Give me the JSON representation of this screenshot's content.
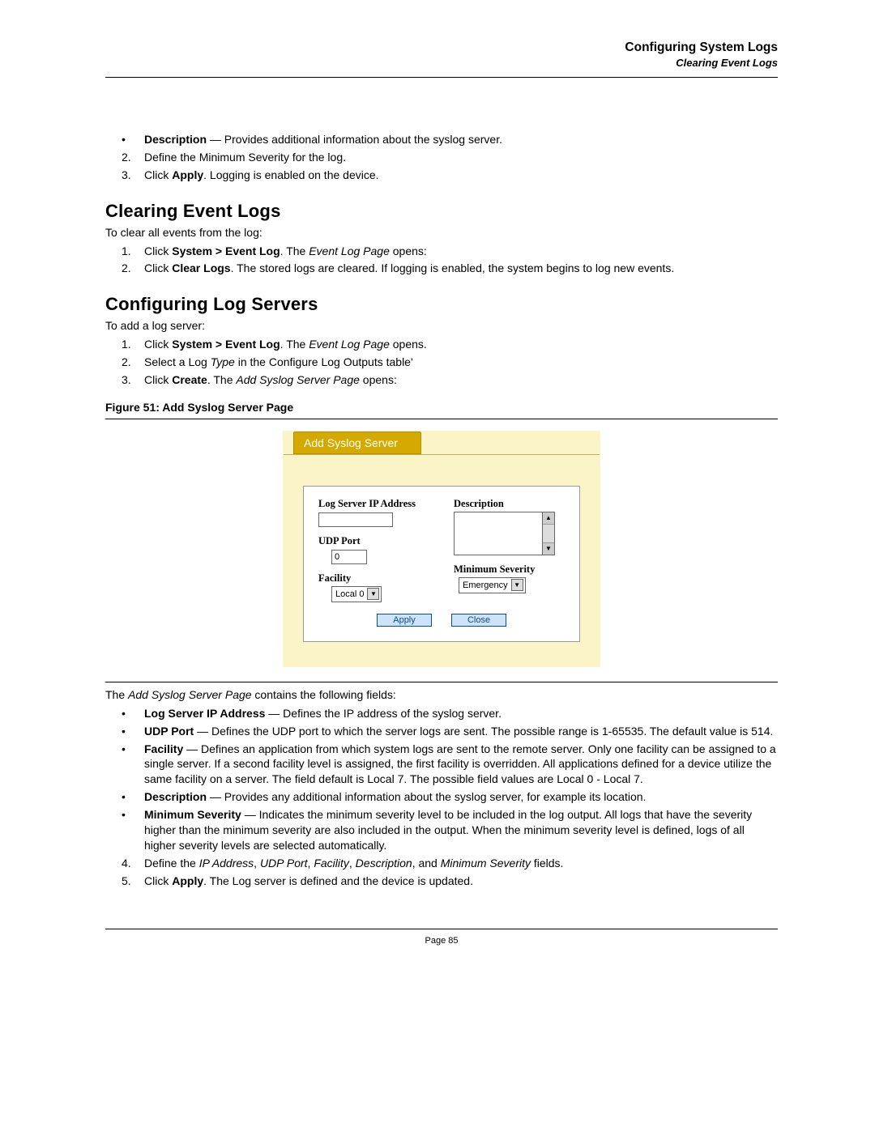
{
  "header": {
    "title": "Configuring System Logs",
    "subtitle": "Clearing Event Logs"
  },
  "intro": {
    "bullet": {
      "label": "Description",
      "dash": " — ",
      "text": "Provides additional information about the syslog server."
    },
    "step2": "Define the Minimum Severity for the log.",
    "step3_pre": "Click ",
    "step3_b": "Apply",
    "step3_post": ". Logging is enabled on the device."
  },
  "clearing": {
    "heading": "Clearing Event Logs",
    "intro": "To clear all events from the log:",
    "s1_pre": "Click ",
    "s1_b": "System > Event Log",
    "s1_mid": ". The ",
    "s1_i": "Event Log Page",
    "s1_post": " opens:",
    "s2_pre": "Click ",
    "s2_b": "Clear Logs",
    "s2_post": ". The stored logs are cleared. If logging is enabled, the system begins to log new events."
  },
  "config": {
    "heading": "Configuring Log Servers",
    "intro": "To add a log server:",
    "s1_pre": "Click ",
    "s1_b": "System > Event Log",
    "s1_mid": ". The ",
    "s1_i": "Event Log Page",
    "s1_post": " opens.",
    "s2_pre": "Select a Log ",
    "s2_i": "Type",
    "s2_post": " in the Configure Log Outputs table'",
    "s3_pre": "Click ",
    "s3_b": "Create",
    "s3_mid": ". The ",
    "s3_i": "Add Syslog Server Page",
    "s3_post": " opens:"
  },
  "figure": {
    "caption": "Figure 51:  Add Syslog Server Page",
    "tab": "Add Syslog Server",
    "labels": {
      "ip": "Log Server IP Address",
      "udp": "UDP Port",
      "udp_value": "0",
      "facility": "Facility",
      "facility_value": "Local 0",
      "description": "Description",
      "min_sev": "Minimum Severity",
      "min_sev_value": "Emergency"
    },
    "buttons": {
      "apply": "Apply",
      "close": "Close"
    }
  },
  "fields_intro_pre": "The ",
  "fields_intro_i": "Add Syslog Server Page",
  "fields_intro_post": " contains the following fields:",
  "fields": {
    "ip_b": "Log Server IP Address",
    "ip_t": " — Defines the IP address of the syslog server.",
    "udp_b": "UDP Port",
    "udp_t": " — Defines the UDP port to which the server logs are sent. The possible range is 1-65535. The default value is 514.",
    "fac_b": "Facility",
    "fac_t": " — Defines an application from which system logs are sent to the remote server. Only one facility can be assigned to a single server. If a second facility level is assigned, the first facility is overridden. All applications defined for a device utilize the same facility on a server. The field default is Local 7. The  possible field values are Local 0 - Local 7.",
    "desc_b": "Description",
    "desc_t": " — Provides any additional information about the syslog server, for example its location.",
    "min_b": "Minimum Severity",
    "min_t": " — Indicates the minimum severity level to be included in the log output. All logs that have the severity higher than the minimum severity are also included in the output. When the minimum severity level is defined, logs of all higher severity levels are selected automatically."
  },
  "closing": {
    "s4_pre": "Define the ",
    "s4_i1": "IP Address",
    "s4_c1": ", ",
    "s4_i2": "UDP Port",
    "s4_c2": ", ",
    "s4_i3": "Facility",
    "s4_c3": ", ",
    "s4_i4": "Description",
    "s4_c4": ", and ",
    "s4_i5": "Minimum Severity",
    "s4_post": " fields.",
    "s5_pre": "Click ",
    "s5_b": "Apply",
    "s5_post": ". The Log server is defined and the device is updated."
  },
  "footer": "Page 85"
}
